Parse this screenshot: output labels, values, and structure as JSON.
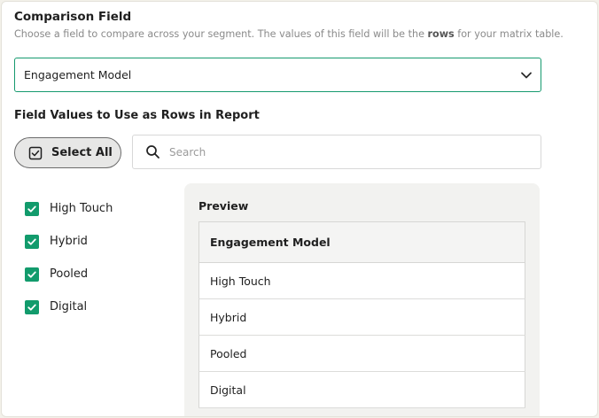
{
  "comparison": {
    "title": "Comparison Field",
    "description_before": "Choose a field to compare across your segment. The values of this field will be the ",
    "description_bold": "rows",
    "description_after": " for your matrix table.",
    "selected_field": "Engagement Model"
  },
  "rows_section": {
    "title": "Field Values to Use as Rows in Report",
    "select_all_label": "Select All",
    "search_placeholder": "Search",
    "options": [
      {
        "label": "High Touch",
        "checked": true
      },
      {
        "label": "Hybrid",
        "checked": true
      },
      {
        "label": "Pooled",
        "checked": true
      },
      {
        "label": "Digital",
        "checked": true
      }
    ]
  },
  "preview": {
    "title": "Preview",
    "header": "Engagement Model",
    "rows": [
      "High Touch",
      "Hybrid",
      "Pooled",
      "Digital"
    ]
  },
  "icons": {
    "select_chevron": "chevron-down-icon",
    "select_all": "checkbox-checked-icon",
    "search": "search-icon",
    "option_check": "checkmark-icon"
  },
  "colors": {
    "accent": "#129b6c",
    "select_border": "#169a6f",
    "background": "#f3f1ea"
  }
}
